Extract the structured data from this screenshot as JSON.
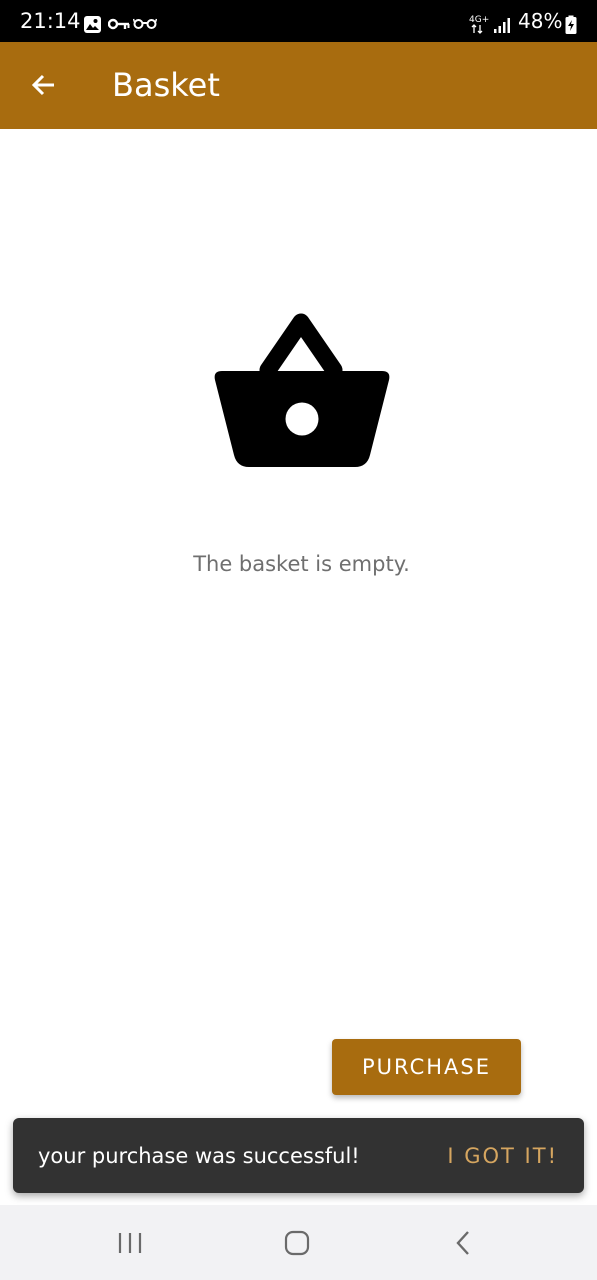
{
  "status_bar": {
    "time": "21:14",
    "network": "4G+",
    "battery": "48%"
  },
  "app_bar": {
    "title": "Basket",
    "background_color": "#a86c0f"
  },
  "main": {
    "empty_icon": "basket-icon",
    "empty_message": "The basket is empty."
  },
  "purchase_button": {
    "label": "PURCHASE"
  },
  "snackbar": {
    "message": "your purchase was successful!",
    "action": "I GOT IT!",
    "action_color": "#d6a660"
  },
  "nav_bar": {
    "icons": [
      "recent-apps-icon",
      "home-icon",
      "back-icon"
    ]
  }
}
